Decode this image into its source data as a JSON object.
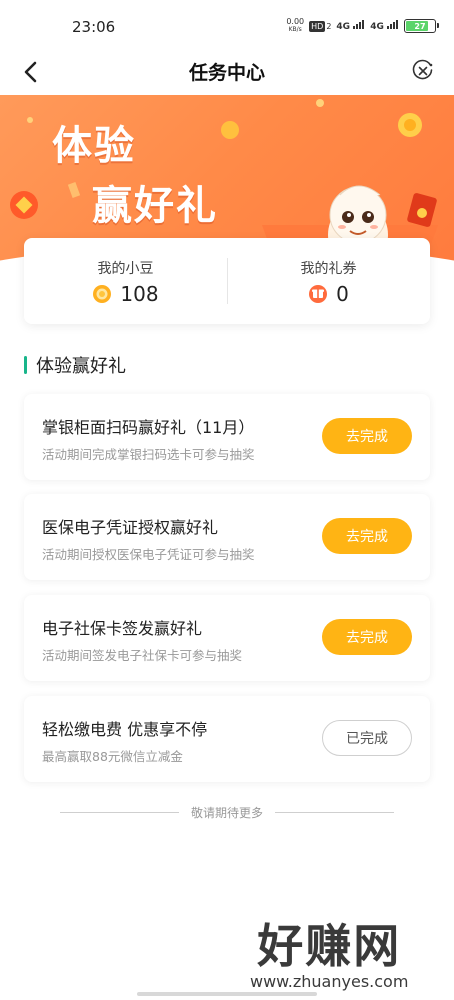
{
  "status_bar": {
    "time": "23:06",
    "net_speed_value": "0.00",
    "net_speed_unit": "KB/s",
    "hd_label": "HD",
    "hd_sub": "2",
    "signal1": "4G",
    "signal2": "4G",
    "battery": "27"
  },
  "nav": {
    "title": "任务中心",
    "back_icon": "chevron-left-icon",
    "close_icon": "close-circle-icon"
  },
  "banner": {
    "line1": "体验",
    "line2": "赢好礼"
  },
  "points": {
    "beans_label": "我的小豆",
    "beans_value": "108",
    "coupons_label": "我的礼券",
    "coupons_value": "0"
  },
  "section": {
    "title": "体验赢好礼"
  },
  "tasks": [
    {
      "title": "掌银柜面扫码赢好礼（11月）",
      "desc": "活动期间完成掌银扫码选卡可参与抽奖",
      "button": "去完成",
      "done": false
    },
    {
      "title": "医保电子凭证授权赢好礼",
      "desc": "活动期间授权医保电子凭证可参与抽奖",
      "button": "去完成",
      "done": false
    },
    {
      "title": "电子社保卡签发赢好礼",
      "desc": "活动期间签发电子社保卡可参与抽奖",
      "button": "去完成",
      "done": false
    },
    {
      "title": "轻松缴电费 优惠享不停",
      "desc": "最高赢取88元微信立减金",
      "button": "已完成",
      "done": true
    }
  ],
  "footer": {
    "more_text": "敬请期待更多"
  },
  "watermark": {
    "main": "好赚网",
    "sub": "www.zhuanyes.com"
  },
  "colors": {
    "banner": "#ff8a48",
    "action_button": "#ffb414",
    "section_accent": "#18b58a"
  }
}
